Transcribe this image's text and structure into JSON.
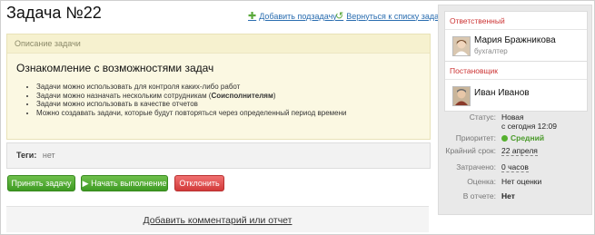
{
  "task": {
    "title": "Задача №22",
    "add_subtask": "Добавить подзадачу",
    "back_to_list": "Вернуться к списку задач",
    "description_header": "Описание задачи",
    "description_title": "Ознакомление с возможностями задач",
    "description_items": [
      "Задачи можно использовать для контроля каких-либо работ",
      "Задачи можно назначать нескольким сотрудникам (",
      "Задачи можно использовать в качестве отчетов",
      "Можно создавать задачи, которые будут повторяться через определенный период времени"
    ],
    "description_item2_bold": "Соисполнителям",
    "description_item2_end": ")",
    "tags_label": "Теги:",
    "tags_value": "нет"
  },
  "actions": {
    "accept": "Принять задачу",
    "start": "Начать выполнение",
    "reject": "Отклонить"
  },
  "comments": {
    "add": "Добавить комментарий или отчет"
  },
  "sidebar": {
    "responsible_header": "Ответственный",
    "responsible_name": "Мария Бражникова",
    "responsible_role": "бухгалтер",
    "creator_header": "Постановщик",
    "creator_name": "Иван Иванов",
    "status_label": "Статус:",
    "status_value": "Новая",
    "status_since": "с сегодня 12:09",
    "priority_label": "Приоритет:",
    "priority_value": "Средний",
    "deadline_label": "Крайний срок:",
    "deadline_value": "22 апреля",
    "spent_label": "Затрачено:",
    "spent_value": "0 часов",
    "rating_label": "Оценка:",
    "rating_value": "Нет оценки",
    "in_report_label": "В отчете:",
    "in_report_value": "Нет"
  },
  "colors": {
    "accent_link": "#2a6db0",
    "green_button": "#4ea82f",
    "red_button": "#d84545",
    "priority_dot": "#55b02e",
    "section_header": "#cc3333"
  },
  "icons": {
    "add_subtask": "plus-icon",
    "back_to_list": "return-arrow-icon",
    "start": "play-icon",
    "priority": "status-dot-icon"
  }
}
